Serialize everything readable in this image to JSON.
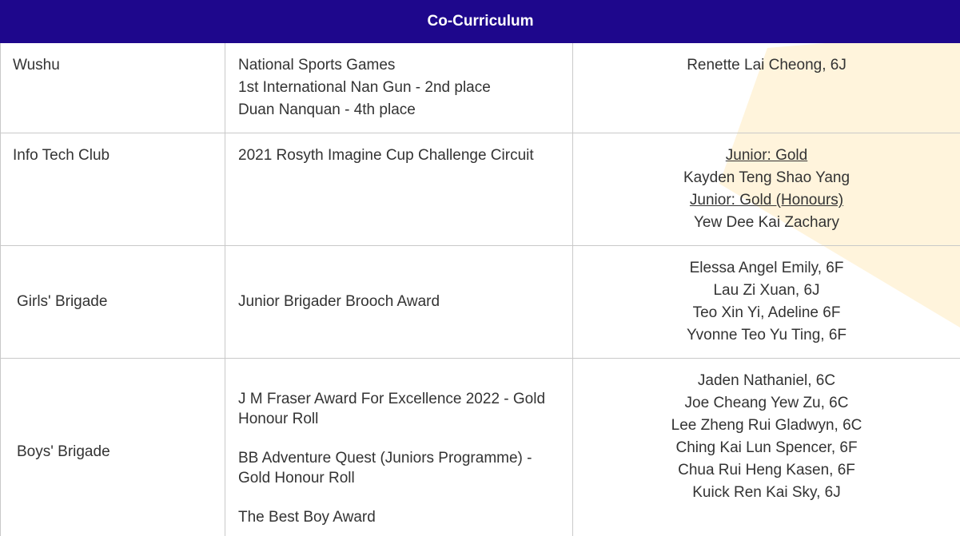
{
  "header": {
    "title": "Co-Curriculum"
  },
  "rows": [
    {
      "category": "Wushu",
      "events": [
        "National Sports Games",
        "1st International Nan Gun - 2nd place",
        "Duan Nanquan - 4th place"
      ],
      "names": [
        "Renette Lai Cheong, 6J"
      ]
    },
    {
      "category": "Info Tech Club",
      "events": [
        "2021 Rosyth Imagine Cup Challenge Circuit"
      ],
      "names": [
        "Junior: Gold ",
        "Kayden Teng Shao Yang",
        "Junior: Gold (Honours)",
        "Yew Dee Kai Zachary"
      ]
    },
    {
      "category": "Girls' Brigade",
      "events": [
        "Junior Brigader Brooch Award"
      ],
      "names": [
        "Elessa Angel Emily, 6F",
        "Lau Zi Xuan, 6J",
        "Teo Xin Yi, Adeline 6F",
        "Yvonne Teo Yu Ting, 6F"
      ]
    },
    {
      "category": "Boys' Brigade",
      "events": [
        "J M Fraser Award For Excellence 2022 - Gold Honour Roll",
        "BB Adventure Quest (Juniors Programme) - Gold Honour Roll",
        "The Best Boy Award"
      ],
      "names": [
        "Jaden Nathaniel, 6C",
        "Joe Cheang Yew Zu, 6C",
        "Lee Zheng Rui Gladwyn, 6C",
        "Ching Kai Lun Spencer, 6F",
        "Chua Rui Heng Kasen, 6F",
        "Kuick Ren Kai Sky, 6J"
      ]
    }
  ],
  "colors": {
    "header_bg": "#1e078c",
    "header_text": "#ffffff",
    "decor": "#fff4dc",
    "border": "#c9c9c9"
  }
}
